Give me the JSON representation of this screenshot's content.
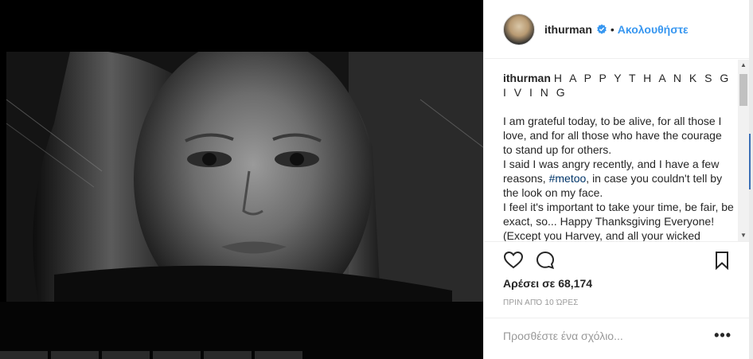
{
  "post": {
    "username": "ithurman",
    "follow_label": "Ακολουθήστε",
    "dot": "•",
    "caption_headline": "H A P P Y T H A N K S G I V I N G",
    "caption_lines": [
      "I am grateful today, to be alive, for all those I love, and for all those who have the courage to stand up for others.",
      "I said I was angry recently, and I have a few reasons, ",
      "#metoo",
      ", in case you couldn't tell by the look on my face.",
      "I feel it's important to take your time, be fair, be exact, so... Happy Thanksgiving Everyone! (Except you Harvey, and all your wicked conspirators - I'm glad it's going"
    ],
    "likes": "Αρέσει σε 68,174",
    "time": "ΠΡΙΝ ΑΠΌ 10 ΏΡΕΣ",
    "comment_placeholder": "Προσθέστε ένα σχόλιο...",
    "more": "•••"
  },
  "icons": {
    "verified": "verified-badge-icon",
    "like": "heart-icon",
    "comment": "comment-bubble-icon",
    "save": "bookmark-icon",
    "options": "ellipsis-icon"
  },
  "colors": {
    "accent": "#3897f0",
    "hashtag": "#003569",
    "text": "#262626",
    "muted": "#999999"
  }
}
